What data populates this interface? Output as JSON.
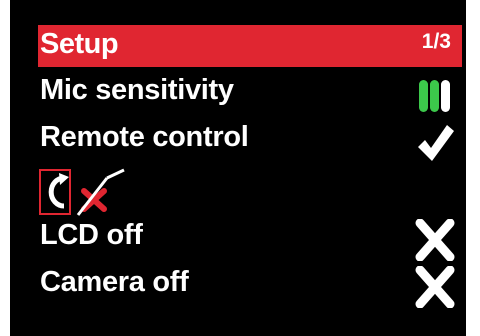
{
  "header": {
    "title": "Setup",
    "page_indicator": "1/3"
  },
  "menu_items": [
    {
      "label": "Mic sensitivity",
      "value_icon": "mic-sensitivity-bars-icon",
      "level_bars_filled": 3
    },
    {
      "label": "Remote control",
      "value_icon": "checkmark-icon"
    },
    {
      "label": "LCD off",
      "value_icon": "cross-icon"
    },
    {
      "label": "Camera off",
      "value_icon": "cross-icon"
    }
  ],
  "status_strip": {
    "icons": [
      "cursor-box-icon",
      "refresh-icon",
      "remote-disabled-icon"
    ]
  },
  "colors": {
    "background": "#000000",
    "accent": "#e02631",
    "bars": "#3cc84b",
    "text": "#ffffff"
  }
}
